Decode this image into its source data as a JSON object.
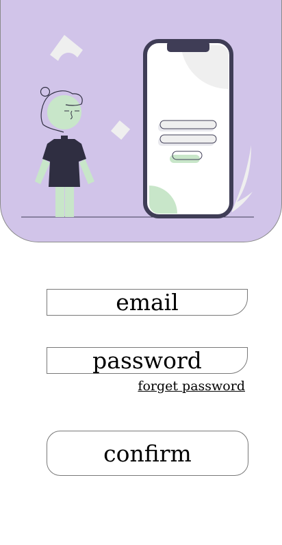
{
  "colors": {
    "header_bg": "#d1c4e9",
    "accent_green": "#c8e6c9",
    "dark": "#3f3d56"
  },
  "illustration": {
    "icon": "person-with-phone-login-illustration"
  },
  "form": {
    "email_placeholder": "email",
    "password_placeholder": "password",
    "forgot_link": "forget password",
    "confirm_label": "confirm"
  }
}
